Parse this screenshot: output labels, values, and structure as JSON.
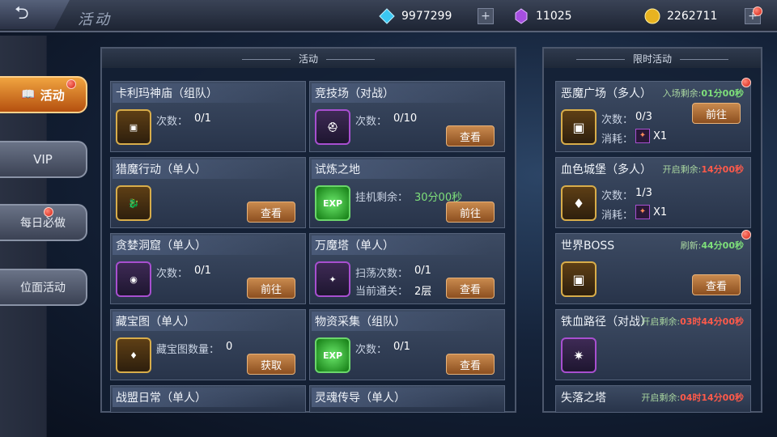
{
  "header": {
    "back_icon": "back-arrow-icon",
    "title": "活动"
  },
  "currencies": [
    {
      "name": "diamond",
      "icon": "diamond-icon",
      "value": "9977299"
    },
    {
      "name": "crystal",
      "icon": "purple-crystal-icon",
      "value": "11025"
    },
    {
      "name": "gold",
      "icon": "gold-coin-icon",
      "value": "2262711"
    }
  ],
  "sidebar": [
    {
      "label": "活动",
      "active": true,
      "badge": true
    },
    {
      "label": "VIP",
      "active": false,
      "badge": false
    },
    {
      "label": "每日必做",
      "active": false,
      "badge": true
    },
    {
      "label": "位面活动",
      "active": false,
      "badge": false
    }
  ],
  "left_panel": {
    "title": "活动"
  },
  "right_panel": {
    "title": "限时活动"
  },
  "activities": [
    {
      "name": "卡利玛神庙（组队）",
      "l1": "次数：",
      "v1": "0/1",
      "l2": "",
      "v2": "",
      "button": "",
      "icon": "treasure-chest-icon"
    },
    {
      "name": "竞技场（对战）",
      "l1": "次数：",
      "v1": "0/10",
      "l2": "",
      "v2": "",
      "button": "查看",
      "icon": "helmet-icon"
    },
    {
      "name": "猎魔行动（单人）",
      "l1": "",
      "v1": "",
      "l2": "",
      "v2": "",
      "button": "查看",
      "icon": "dragon-icon"
    },
    {
      "name": "试炼之地",
      "l1": "挂机剩余：",
      "v1": "30分00秒",
      "l2": "",
      "v2": "",
      "button": "前往",
      "icon": "exp-orb-icon"
    },
    {
      "name": "贪婪洞窟（单人）",
      "l1": "次数：",
      "v1": "0/1",
      "l2": "",
      "v2": "",
      "button": "前往",
      "icon": "gold-pile-icon"
    },
    {
      "name": "万魔塔（单人）",
      "l1": "扫荡次数：",
      "v1": "0/1",
      "l2": "当前通关：",
      "v2": "2层",
      "button": "查看",
      "icon": "demon-armor-icon"
    },
    {
      "name": "藏宝图（单人）",
      "l1": "藏宝图数量：",
      "v1": "0",
      "l2": "",
      "v2": "",
      "button": "获取",
      "icon": "red-gem-icon"
    },
    {
      "name": "物资采集（组队）",
      "l1": "次数：",
      "v1": "0/1",
      "l2": "",
      "v2": "",
      "button": "查看",
      "icon": "exp-orb-icon"
    },
    {
      "name": "战盟日常（单人）",
      "l1": "",
      "v1": "",
      "l2": "",
      "v2": "",
      "button": "",
      "icon": ""
    },
    {
      "name": "灵魂传导（单人）",
      "l1": "",
      "v1": "",
      "l2": "",
      "v2": "",
      "button": "",
      "icon": ""
    }
  ],
  "limited": [
    {
      "name": "恶魔广场（多人）",
      "time_label": "入场剩余:",
      "time": "01分00秒",
      "time_color": "#7ee07a",
      "l1": "次数：",
      "v1": "0/3",
      "l2": "消耗：",
      "v2": "X1",
      "button": "前往",
      "badge": true,
      "icon": "treasure-chest-icon"
    },
    {
      "name": "血色城堡（多人）",
      "time_label": "开启剩余:",
      "time": "14分00秒",
      "time_color": "#ff5a4a",
      "l1": "次数：",
      "v1": "1/3",
      "l2": "消耗：",
      "v2": "X1",
      "button": "",
      "badge": false,
      "icon": "red-gem-icon"
    },
    {
      "name": "世界BOSS",
      "time_label": "刷新:",
      "time": "44分00秒",
      "time_color": "#7ee07a",
      "l1": "",
      "v1": "",
      "l2": "",
      "v2": "",
      "button": "查看",
      "badge": true,
      "icon": "treasure-chest-icon"
    },
    {
      "name": "铁血路径（对战）",
      "time_label": "开启剩余:",
      "time": "03时44分00秒",
      "time_color": "#ff5a4a",
      "l1": "",
      "v1": "",
      "l2": "",
      "v2": "",
      "button": "",
      "badge": false,
      "icon": "spiked-badge-icon"
    },
    {
      "name": "失落之塔",
      "time_label": "开启剩余:",
      "time": "04时14分00秒",
      "time_color": "#ff5a4a",
      "l1": "",
      "v1": "",
      "l2": "",
      "v2": "",
      "button": "",
      "badge": false,
      "icon": ""
    }
  ]
}
